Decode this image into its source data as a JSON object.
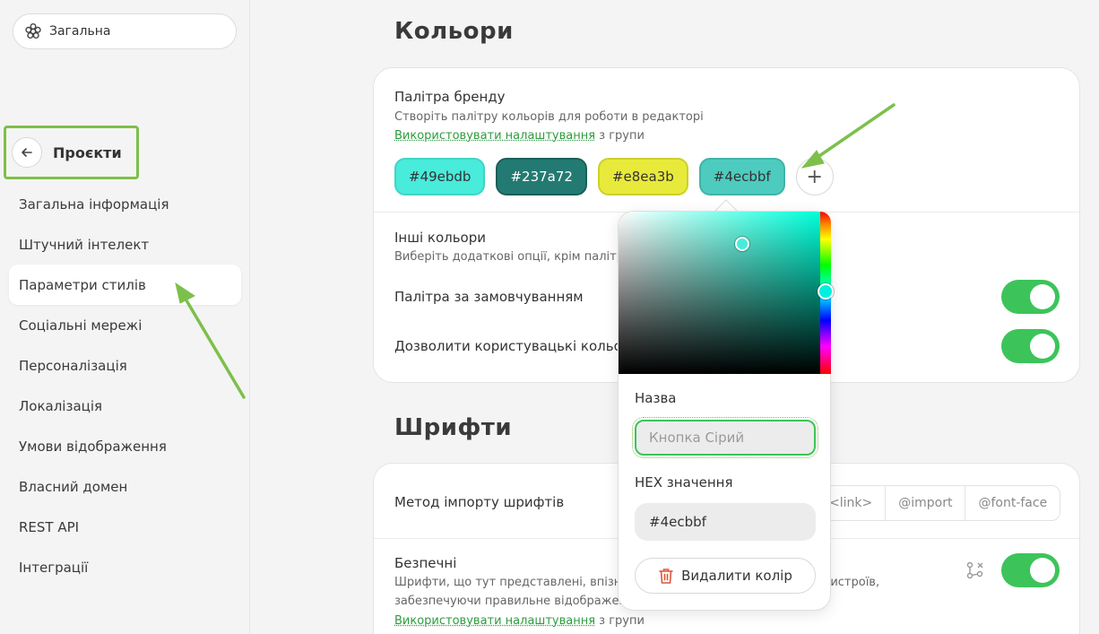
{
  "sidebar": {
    "workspace_label": "Загальна",
    "projects_title": "Проєкти",
    "items": [
      {
        "label": "Загальна інформація"
      },
      {
        "label": "Штучний інтелект"
      },
      {
        "label": "Параметри стилів"
      },
      {
        "label": "Соціальні мережі"
      },
      {
        "label": "Персоналізація"
      },
      {
        "label": "Локалізація"
      },
      {
        "label": "Умови відображення"
      },
      {
        "label": "Власний домен"
      },
      {
        "label": "REST API"
      },
      {
        "label": "Інтеграції"
      }
    ],
    "active_item": "Параметри стилів"
  },
  "colors_section": {
    "title": "Кольори",
    "brand_palette": {
      "title": "Палітра бренду",
      "description": "Створіть палітру кольорів для роботи в редакторі",
      "link": "Використовувати налаштування",
      "link_suffix": " з групи",
      "swatches": [
        {
          "label": "#49ebdb",
          "color": "#49ebdb"
        },
        {
          "label": "#237a72",
          "color": "#237a72"
        },
        {
          "label": "#e8ea3b",
          "color": "#e8ea3b"
        },
        {
          "label": "#4ecbbf",
          "color": "#4ecbbf"
        }
      ],
      "add_label": "+"
    },
    "other_colors": {
      "title": "Інші кольори",
      "description": "Виберіть додаткові опції, крім палітри",
      "default_palette": "Палітра за замовчуванням",
      "allow_custom": "Дозволити користувацькі кольори"
    }
  },
  "fonts_section": {
    "title": "Шрифти",
    "import_method": {
      "label": "Метод імпорту шрифтів",
      "options": [
        "<link>",
        "@import",
        "@font-face"
      ]
    },
    "safe": {
      "title": "Безпечні",
      "description_line1": "Шрифти, що тут представлені, впізнаються більшістю браузерів та пристроїв,",
      "description_line2": "забезпечуючи правильне відображення",
      "link": "Використовувати налаштування",
      "link_suffix": " з групи"
    }
  },
  "color_picker": {
    "name_label": "Назва",
    "name_placeholder": "Кнопка Сірий",
    "hex_label": "HEX значення",
    "hex_value": "#4ecbbf",
    "delete_label": "Видалити колір"
  },
  "accent": {
    "green": "#3cc45a",
    "annotation": "#7cc04b"
  }
}
